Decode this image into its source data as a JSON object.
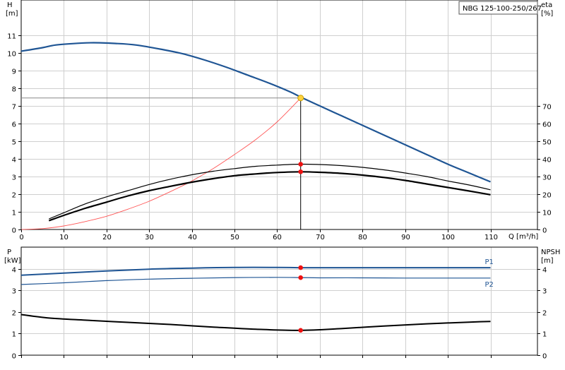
{
  "model_label": "NBG 125-100-250/267",
  "chart_data": [
    {
      "type": "line",
      "panel": "upper",
      "title": "",
      "left_axis_label": "H",
      "left_axis_unit": "[m]",
      "right_axis_label": "eta",
      "right_axis_unit": "[%]",
      "xlabel": "Q [m³/h]",
      "xlim": [
        0,
        110
      ],
      "x_ticks": [
        0,
        10,
        20,
        30,
        40,
        50,
        60,
        70,
        80,
        90,
        100,
        110
      ],
      "left_ylim": [
        0,
        12
      ],
      "left_ticks": [
        0,
        1,
        2,
        3,
        4,
        5,
        6,
        7,
        8,
        9,
        10,
        11
      ],
      "right_ticks": [
        0,
        10,
        20,
        30,
        40,
        50,
        60,
        70
      ],
      "right_ylim_scale": "eta = 10 × H-scale",
      "grid": true,
      "series": [
        {
          "name": "",
          "color": "#1f5594",
          "width": 2.2,
          "axis": "left",
          "points": [
            [
              0,
              10.1
            ],
            [
              5,
              10.3
            ],
            [
              8,
              10.45
            ],
            [
              12,
              10.53
            ],
            [
              17,
              10.58
            ],
            [
              22,
              10.54
            ],
            [
              27,
              10.45
            ],
            [
              33,
              10.2
            ],
            [
              38,
              9.95
            ],
            [
              43,
              9.6
            ],
            [
              48,
              9.2
            ],
            [
              53,
              8.75
            ],
            [
              58,
              8.3
            ],
            [
              63,
              7.8
            ],
            [
              65.5,
              7.5
            ],
            [
              70,
              7.0
            ],
            [
              75,
              6.45
            ],
            [
              80,
              5.9
            ],
            [
              85,
              5.35
            ],
            [
              90,
              4.8
            ],
            [
              95,
              4.25
            ],
            [
              100,
              3.7
            ],
            [
              105,
              3.2
            ],
            [
              110,
              2.7
            ]
          ]
        },
        {
          "name": "",
          "color": "#ff5555",
          "width": 0.9,
          "axis": "left",
          "points": [
            [
              0,
              0
            ],
            [
              5,
              0.05
            ],
            [
              10,
              0.2
            ],
            [
              15,
              0.45
            ],
            [
              20,
              0.75
            ],
            [
              25,
              1.15
            ],
            [
              30,
              1.6
            ],
            [
              35,
              2.15
            ],
            [
              40,
              2.75
            ],
            [
              45,
              3.45
            ],
            [
              50,
              4.25
            ],
            [
              55,
              5.1
            ],
            [
              60,
              6.1
            ],
            [
              65.5,
              7.45
            ]
          ]
        },
        {
          "name": "",
          "color": "#000000",
          "width": 1.2,
          "axis": "left",
          "points": [
            [
              6.5,
              0.6
            ],
            [
              10,
              0.95
            ],
            [
              15,
              1.45
            ],
            [
              20,
              1.85
            ],
            [
              25,
              2.2
            ],
            [
              30,
              2.55
            ],
            [
              35,
              2.85
            ],
            [
              40,
              3.1
            ],
            [
              45,
              3.3
            ],
            [
              50,
              3.45
            ],
            [
              55,
              3.58
            ],
            [
              60,
              3.65
            ],
            [
              65.5,
              3.7
            ],
            [
              70,
              3.68
            ],
            [
              75,
              3.62
            ],
            [
              80,
              3.52
            ],
            [
              85,
              3.38
            ],
            [
              90,
              3.2
            ],
            [
              95,
              3.0
            ],
            [
              100,
              2.75
            ],
            [
              105,
              2.52
            ],
            [
              110,
              2.25
            ]
          ]
        },
        {
          "name": "",
          "color": "#000000",
          "width": 2.2,
          "axis": "left",
          "points": [
            [
              6.5,
              0.5
            ],
            [
              10,
              0.8
            ],
            [
              15,
              1.2
            ],
            [
              20,
              1.55
            ],
            [
              25,
              1.9
            ],
            [
              30,
              2.2
            ],
            [
              35,
              2.45
            ],
            [
              40,
              2.68
            ],
            [
              45,
              2.88
            ],
            [
              50,
              3.05
            ],
            [
              55,
              3.15
            ],
            [
              60,
              3.23
            ],
            [
              65.5,
              3.27
            ],
            [
              70,
              3.24
            ],
            [
              75,
              3.18
            ],
            [
              80,
              3.08
            ],
            [
              85,
              2.95
            ],
            [
              90,
              2.78
            ],
            [
              95,
              2.58
            ],
            [
              100,
              2.38
            ],
            [
              105,
              2.18
            ],
            [
              110,
              1.97
            ]
          ]
        }
      ],
      "operating_point": {
        "q": 65.5,
        "h": 7.45,
        "eta_point": 3.7,
        "eff_point": 3.27
      },
      "ref_line_h": 7.45
    },
    {
      "type": "line",
      "panel": "lower",
      "title": "",
      "left_axis_label": "P",
      "left_axis_unit": "[kW]",
      "right_axis_label": "NPSH",
      "right_axis_unit": "[m]",
      "xlim": [
        0,
        110
      ],
      "x_ticks": [
        0,
        10,
        20,
        30,
        40,
        50,
        60,
        70,
        80,
        90,
        100,
        110
      ],
      "ylim": [
        0,
        4.5
      ],
      "left_ticks": [
        0,
        1,
        2,
        3,
        4
      ],
      "right_ticks": [
        0,
        1,
        2,
        3,
        4
      ],
      "grid": true,
      "series": [
        {
          "name": "P1",
          "color": "#1f5594",
          "width": 2.0,
          "points": [
            [
              0,
              3.7
            ],
            [
              10,
              3.8
            ],
            [
              20,
              3.9
            ],
            [
              30,
              3.98
            ],
            [
              40,
              4.03
            ],
            [
              50,
              4.06
            ],
            [
              60,
              4.06
            ],
            [
              65.5,
              4.05
            ],
            [
              70,
              4.05
            ],
            [
              80,
              4.05
            ],
            [
              90,
              4.05
            ],
            [
              100,
              4.05
            ],
            [
              110,
              4.05
            ]
          ]
        },
        {
          "name": "P2",
          "color": "#1f5594",
          "width": 1.2,
          "points": [
            [
              0,
              3.27
            ],
            [
              10,
              3.35
            ],
            [
              20,
              3.45
            ],
            [
              30,
              3.52
            ],
            [
              40,
              3.56
            ],
            [
              50,
              3.59
            ],
            [
              60,
              3.6
            ],
            [
              65.5,
              3.59
            ],
            [
              70,
              3.58
            ],
            [
              80,
              3.58
            ],
            [
              90,
              3.57
            ],
            [
              100,
              3.57
            ],
            [
              110,
              3.57
            ]
          ]
        },
        {
          "name": "",
          "color": "#000000",
          "width": 2.0,
          "points": [
            [
              0,
              1.88
            ],
            [
              6.5,
              1.72
            ],
            [
              15,
              1.62
            ],
            [
              25,
              1.52
            ],
            [
              35,
              1.42
            ],
            [
              45,
              1.3
            ],
            [
              55,
              1.2
            ],
            [
              65.5,
              1.15
            ],
            [
              75,
              1.23
            ],
            [
              85,
              1.35
            ],
            [
              95,
              1.45
            ],
            [
              105,
              1.53
            ],
            [
              110,
              1.56
            ]
          ]
        }
      ],
      "operating_points": [
        4.05,
        3.59,
        1.15
      ],
      "operating_q": 65.5
    }
  ]
}
